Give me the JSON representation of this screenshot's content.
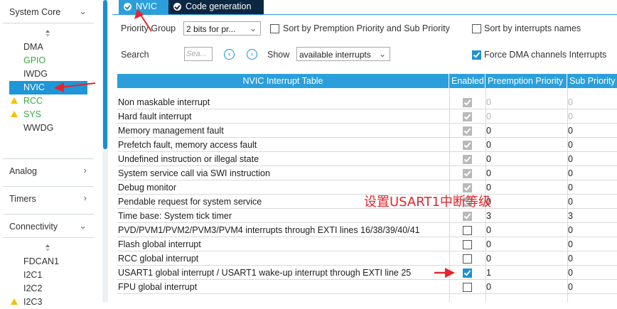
{
  "sidebar": {
    "sections": [
      {
        "label": "System Core",
        "state": "expanded"
      },
      {
        "label": "Analog",
        "state": "collapsed"
      },
      {
        "label": "Timers",
        "state": "collapsed"
      },
      {
        "label": "Connectivity",
        "state": "expanded"
      }
    ],
    "system_core_items": [
      {
        "label": "DMA",
        "status": "normal"
      },
      {
        "label": "GPIO",
        "status": "configured"
      },
      {
        "label": "IWDG",
        "status": "normal"
      },
      {
        "label": "NVIC",
        "status": "selected"
      },
      {
        "label": "RCC",
        "status": "warning"
      },
      {
        "label": "SYS",
        "status": "warning"
      },
      {
        "label": "WWDG",
        "status": "normal"
      }
    ],
    "connectivity_items": [
      {
        "label": "FDCAN1",
        "status": "normal"
      },
      {
        "label": "I2C1",
        "status": "normal"
      },
      {
        "label": "I2C2",
        "status": "normal"
      },
      {
        "label": "I2C3",
        "status": "warning"
      }
    ]
  },
  "tabs": [
    {
      "label": "NVIC",
      "active": true
    },
    {
      "label": "Code generation",
      "active": false
    }
  ],
  "controls": {
    "priority_group_label": "Priority Group",
    "priority_group_value": "2 bits for pr...",
    "sort_premption_label": "Sort by Premption Priority and Sub Priority",
    "sort_premption_checked": false,
    "sort_names_label": "Sort by interrupts names",
    "sort_names_checked": false,
    "search_label": "Search",
    "search_placeholder": "Sea...",
    "show_label": "Show",
    "show_value": "available interrupts",
    "force_dma_label": "Force DMA channels Interrupts",
    "force_dma_checked": true
  },
  "table": {
    "headers": [
      "NVIC Interrupt Table",
      "Enabled",
      "Preemption Priority",
      "Sub Priority"
    ],
    "rows": [
      {
        "name": "Non maskable interrupt",
        "enabled": true,
        "locked": true,
        "preemption": "0",
        "sub": "0",
        "dim": true
      },
      {
        "name": "Hard fault interrupt",
        "enabled": true,
        "locked": true,
        "preemption": "0",
        "sub": "0",
        "dim": true
      },
      {
        "name": "Memory management fault",
        "enabled": true,
        "locked": true,
        "preemption": "0",
        "sub": "0",
        "dim": false
      },
      {
        "name": "Prefetch fault, memory access fault",
        "enabled": true,
        "locked": true,
        "preemption": "0",
        "sub": "0",
        "dim": false
      },
      {
        "name": "Undefined instruction or illegal state",
        "enabled": true,
        "locked": true,
        "preemption": "0",
        "sub": "0",
        "dim": false
      },
      {
        "name": "System service call via SWI instruction",
        "enabled": true,
        "locked": true,
        "preemption": "0",
        "sub": "0",
        "dim": false
      },
      {
        "name": "Debug monitor",
        "enabled": true,
        "locked": true,
        "preemption": "0",
        "sub": "0",
        "dim": false
      },
      {
        "name": "Pendable request for system service",
        "enabled": true,
        "locked": true,
        "preemption": "0",
        "sub": "0",
        "dim": false
      },
      {
        "name": "Time base: System tick timer",
        "enabled": true,
        "locked": true,
        "preemption": "3",
        "sub": "3",
        "dim": false
      },
      {
        "name": "PVD/PVM1/PVM2/PVM3/PVM4 interrupts through EXTI lines 16/38/39/40/41",
        "enabled": false,
        "locked": false,
        "preemption": "0",
        "sub": "0",
        "dim": false
      },
      {
        "name": "Flash global interrupt",
        "enabled": false,
        "locked": false,
        "preemption": "0",
        "sub": "0",
        "dim": false
      },
      {
        "name": "RCC global interrupt",
        "enabled": false,
        "locked": false,
        "preemption": "0",
        "sub": "0",
        "dim": false
      },
      {
        "name": "USART1 global interrupt / USART1 wake-up interrupt through EXTI line 25",
        "enabled": true,
        "locked": false,
        "preemption": "1",
        "sub": "0",
        "dim": false
      },
      {
        "name": "FPU global interrupt",
        "enabled": false,
        "locked": false,
        "preemption": "0",
        "sub": "0",
        "dim": false
      }
    ]
  },
  "annotation": {
    "text": "设置USART1中断等级",
    "color": "#e8242a"
  },
  "colors": {
    "accent": "#2b9fdb",
    "selected": "#1e96d7",
    "dark_tab": "#0b2742",
    "configured": "#3aa845",
    "warning": "#f2c200"
  }
}
